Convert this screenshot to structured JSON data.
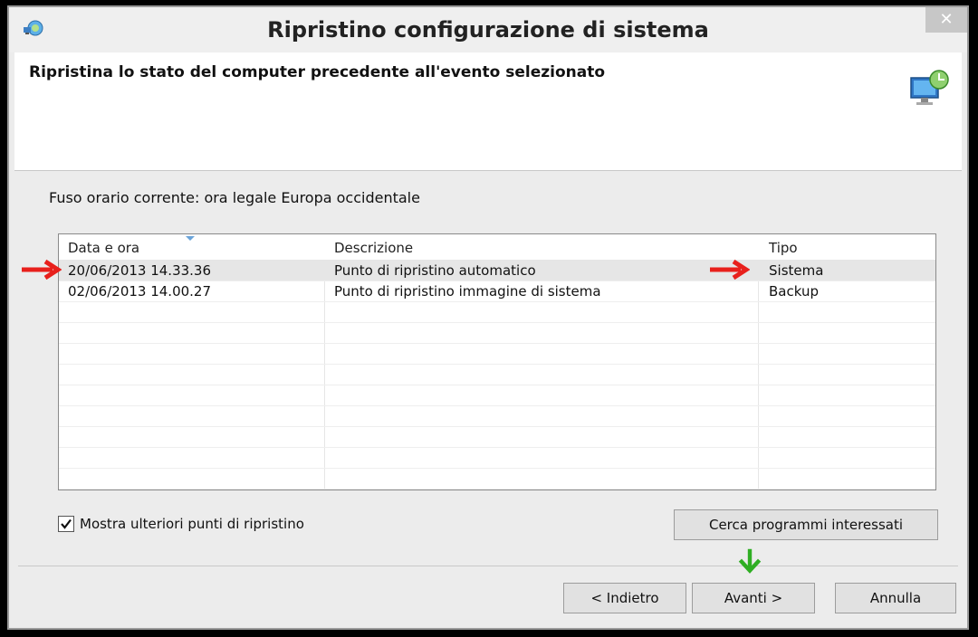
{
  "window": {
    "title": "Ripristino configurazione di sistema",
    "close_glyph": "✕"
  },
  "header": {
    "instruction": "Ripristina lo stato del computer precedente all'evento selezionato"
  },
  "timezone_text": "Fuso orario corrente: ora legale Europa occidentale",
  "table": {
    "columns": [
      "Data e ora",
      "Descrizione",
      "Tipo"
    ],
    "rows": [
      {
        "date": "20/06/2013 14.33.36",
        "description": "Punto di ripristino automatico",
        "type": "Sistema"
      },
      {
        "date": "02/06/2013 14.00.27",
        "description": "Punto di ripristino immagine di sistema",
        "type": "Backup"
      }
    ]
  },
  "checkbox": {
    "label": "Mostra ulteriori punti di ripristino",
    "checked": true
  },
  "buttons": {
    "scan": "Cerca programmi interessati",
    "back": "< Indietro",
    "next": "Avanti >",
    "cancel": "Annulla"
  },
  "colors": {
    "annotation_red": "#e8201c",
    "annotation_green": "#2fae23"
  }
}
